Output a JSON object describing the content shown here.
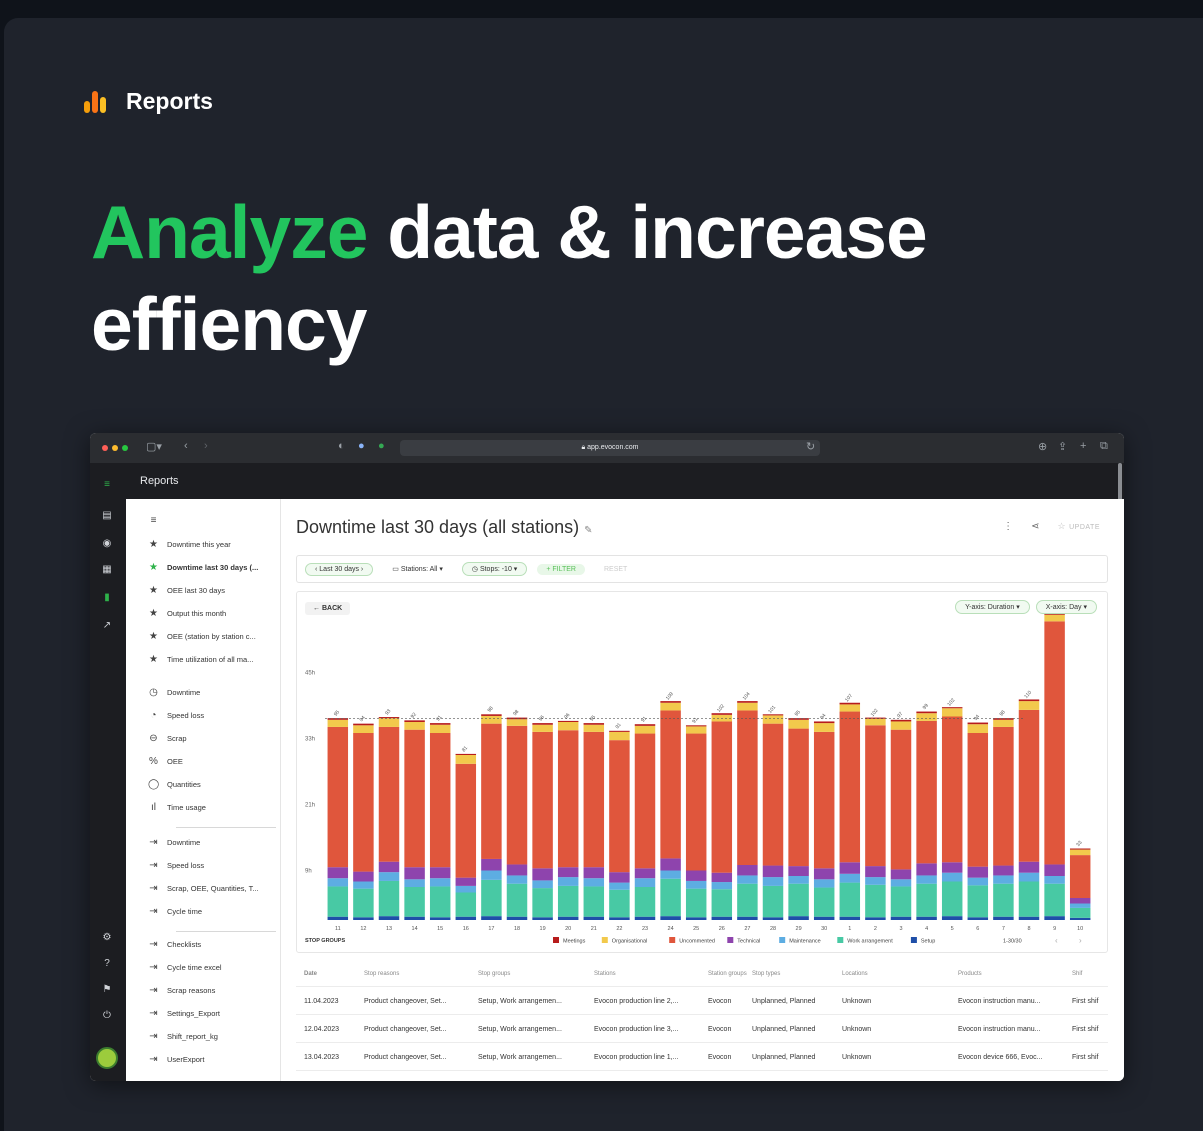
{
  "hero": {
    "section_label": "Reports",
    "headline_accent": "Analyze",
    "headline_rest": " data & increase effiency",
    "brand_green": "#22c55e",
    "bar_icon_colors": [
      "#f59e0b",
      "#f97316",
      "#fbbf24"
    ]
  },
  "browser": {
    "url": "app.evocon.com",
    "app_title": "Reports"
  },
  "menu": {
    "saved": [
      {
        "label": "Downtime this year",
        "icon": "star-icon",
        "active": false
      },
      {
        "label": "Downtime last 30 days (...",
        "icon": "star-icon",
        "active": true
      },
      {
        "label": "OEE last 30 days",
        "icon": "star-icon",
        "active": false
      },
      {
        "label": "Output this month",
        "icon": "star-icon",
        "active": false
      },
      {
        "label": "OEE (station by station c...",
        "icon": "star-icon",
        "active": false
      },
      {
        "label": "Time utilization of all ma...",
        "icon": "star-icon",
        "active": false
      }
    ],
    "reports": [
      {
        "label": "Downtime",
        "icon": "clock-icon"
      },
      {
        "label": "Speed loss",
        "icon": "speed-icon"
      },
      {
        "label": "Scrap",
        "icon": "minus-circle-icon"
      },
      {
        "label": "OEE",
        "icon": "percent-icon"
      },
      {
        "label": "Quantities",
        "icon": "quantities-icon"
      },
      {
        "label": "Time usage",
        "icon": "bars-icon"
      }
    ],
    "exports": [
      {
        "label": "Downtime",
        "icon": "export-icon"
      },
      {
        "label": "Speed loss",
        "icon": "export-icon"
      },
      {
        "label": "Scrap, OEE, Quantities, T...",
        "icon": "export-icon"
      },
      {
        "label": "Cycle time",
        "icon": "export-icon"
      }
    ],
    "custom": [
      {
        "label": "Checklists",
        "icon": "export-icon"
      },
      {
        "label": "Cycle time excel",
        "icon": "export-icon"
      },
      {
        "label": "Scrap reasons",
        "icon": "export-icon"
      },
      {
        "label": "Settings_Export",
        "icon": "export-icon"
      },
      {
        "label": "Shift_report_kg",
        "icon": "export-icon"
      },
      {
        "label": "UserExport",
        "icon": "export-icon"
      }
    ]
  },
  "main": {
    "title": "Downtime last 30 days (all stations)",
    "update_label": "UPDATE",
    "filters": {
      "period": "Last 30 days",
      "stations": "Stations: All",
      "stops": "Stops: -10",
      "add_filter": "FILTER",
      "reset": "RESET"
    },
    "back_label": "BACK",
    "y_axis_chip": "Y-axis: Duration",
    "x_axis_chip": "X-axis: Day",
    "legend_title": "STOP GROUPS",
    "legend_page": "1-30/30"
  },
  "chart_data": {
    "type": "bar",
    "stacked": true,
    "ylabel_ticks": [
      "9h",
      "21h",
      "33h",
      "45h"
    ],
    "ylim": [
      0,
      48
    ],
    "categories": [
      "11",
      "12",
      "13",
      "14",
      "15",
      "16",
      "17",
      "18",
      "19",
      "20",
      "21",
      "22",
      "23",
      "24",
      "25",
      "26",
      "27",
      "28",
      "29",
      "30",
      "1",
      "2",
      "3",
      "4",
      "5",
      "6",
      "7",
      "8",
      "9",
      "10"
    ],
    "totals": [
      95,
      94,
      93,
      92,
      91,
      81,
      98,
      98,
      96,
      96,
      95,
      91,
      91,
      109,
      91,
      102,
      104,
      101,
      95,
      94,
      107,
      102,
      97,
      99,
      102,
      94,
      98,
      110,
      151,
      33
    ],
    "series": [
      {
        "name": "Meetings",
        "color": "#b71c1c",
        "values": [
          0.3,
          0.3,
          0.2,
          0.3,
          0.3,
          0.2,
          0.3,
          0.3,
          0.3,
          0.2,
          0.3,
          0.2,
          0.3,
          0.3,
          0.2,
          0.3,
          0.3,
          0.2,
          0.3,
          0.3,
          0.3,
          0.2,
          0.3,
          0.3,
          0.2,
          0.3,
          0.3,
          0.3,
          0.3,
          0.2
        ]
      },
      {
        "name": "Organisational",
        "color": "#f2c94c",
        "values": [
          1.3,
          1.4,
          1.6,
          1.4,
          1.5,
          1.6,
          1.4,
          1.2,
          1.3,
          1.5,
          1.3,
          1.5,
          1.4,
          1.4,
          1.3,
          1.2,
          1.4,
          1.5,
          1.6,
          1.6,
          1.3,
          1.2,
          1.5,
          1.4,
          1.5,
          1.6,
          1.3,
          1.6,
          1.2,
          1.0
        ]
      },
      {
        "name": "Uncommented",
        "color": "#e0563c",
        "values": [
          25.5,
          25.2,
          24.5,
          25.0,
          24.4,
          20.7,
          24.6,
          25.2,
          24.8,
          24.9,
          24.6,
          24.0,
          24.5,
          26.9,
          24.9,
          27.5,
          28.1,
          25.8,
          25.0,
          24.8,
          27.4,
          25.6,
          25.4,
          25.9,
          26.5,
          24.3,
          25.2,
          27.6,
          44.2,
          7.8
        ]
      },
      {
        "name": "Technical",
        "color": "#8e44ad",
        "values": [
          2.0,
          1.8,
          1.9,
          2.2,
          2.0,
          1.5,
          2.1,
          2.0,
          2.2,
          1.8,
          2.0,
          1.9,
          1.8,
          2.2,
          1.9,
          1.7,
          1.9,
          2.1,
          1.8,
          2.0,
          2.1,
          2.0,
          1.8,
          2.2,
          1.9,
          2.0,
          1.8,
          2.0,
          2.1,
          1.0
        ]
      },
      {
        "name": "Maintenance",
        "color": "#5dade2",
        "values": [
          1.5,
          1.3,
          1.6,
          1.4,
          1.5,
          1.2,
          1.7,
          1.5,
          1.4,
          1.6,
          1.5,
          1.3,
          1.6,
          1.5,
          1.4,
          1.3,
          1.5,
          1.6,
          1.4,
          1.5,
          1.6,
          1.4,
          1.3,
          1.5,
          1.6,
          1.4,
          1.5,
          1.6,
          1.4,
          0.8
        ]
      },
      {
        "name": "Work arrangement",
        "color": "#48c9a4",
        "values": [
          5.5,
          5.2,
          6.4,
          5.4,
          5.6,
          4.4,
          6.6,
          6.0,
          5.3,
          5.6,
          5.5,
          5.0,
          5.4,
          6.8,
          5.2,
          5.0,
          6.0,
          5.7,
          5.9,
          5.3,
          6.2,
          5.9,
          5.5,
          6.0,
          6.3,
          5.8,
          6.0,
          6.4,
          5.9,
          1.8
        ]
      },
      {
        "name": "Setup",
        "color": "#1f4fa8",
        "values": [
          0.6,
          0.5,
          0.7,
          0.6,
          0.5,
          0.6,
          0.7,
          0.6,
          0.5,
          0.6,
          0.6,
          0.5,
          0.6,
          0.7,
          0.5,
          0.6,
          0.6,
          0.5,
          0.7,
          0.6,
          0.6,
          0.5,
          0.6,
          0.6,
          0.7,
          0.5,
          0.6,
          0.6,
          0.7,
          0.4
        ]
      }
    ],
    "average_line": 36.6
  },
  "table": {
    "headers": [
      "Date",
      "Stop reasons",
      "Stop groups",
      "Stations",
      "Station groups",
      "Stop types",
      "Locations",
      "Products",
      "Shif"
    ],
    "rows": [
      [
        "11.04.2023",
        "Product changeover, Set...",
        "Setup, Work arrangemen...",
        "Evocon production line 2,...",
        "Evocon",
        "Unplanned, Planned",
        "Unknown",
        "Evocon instruction manu...",
        "First shif"
      ],
      [
        "12.04.2023",
        "Product changeover, Set...",
        "Setup, Work arrangemen...",
        "Evocon production line 3,...",
        "Evocon",
        "Unplanned, Planned",
        "Unknown",
        "Evocon instruction manu...",
        "First shif"
      ],
      [
        "13.04.2023",
        "Product changeover, Set...",
        "Setup, Work arrangemen...",
        "Evocon production line 1,...",
        "Evocon",
        "Unplanned, Planned",
        "Unknown",
        "Evocon device 666, Evoc...",
        "First shif"
      ]
    ]
  }
}
